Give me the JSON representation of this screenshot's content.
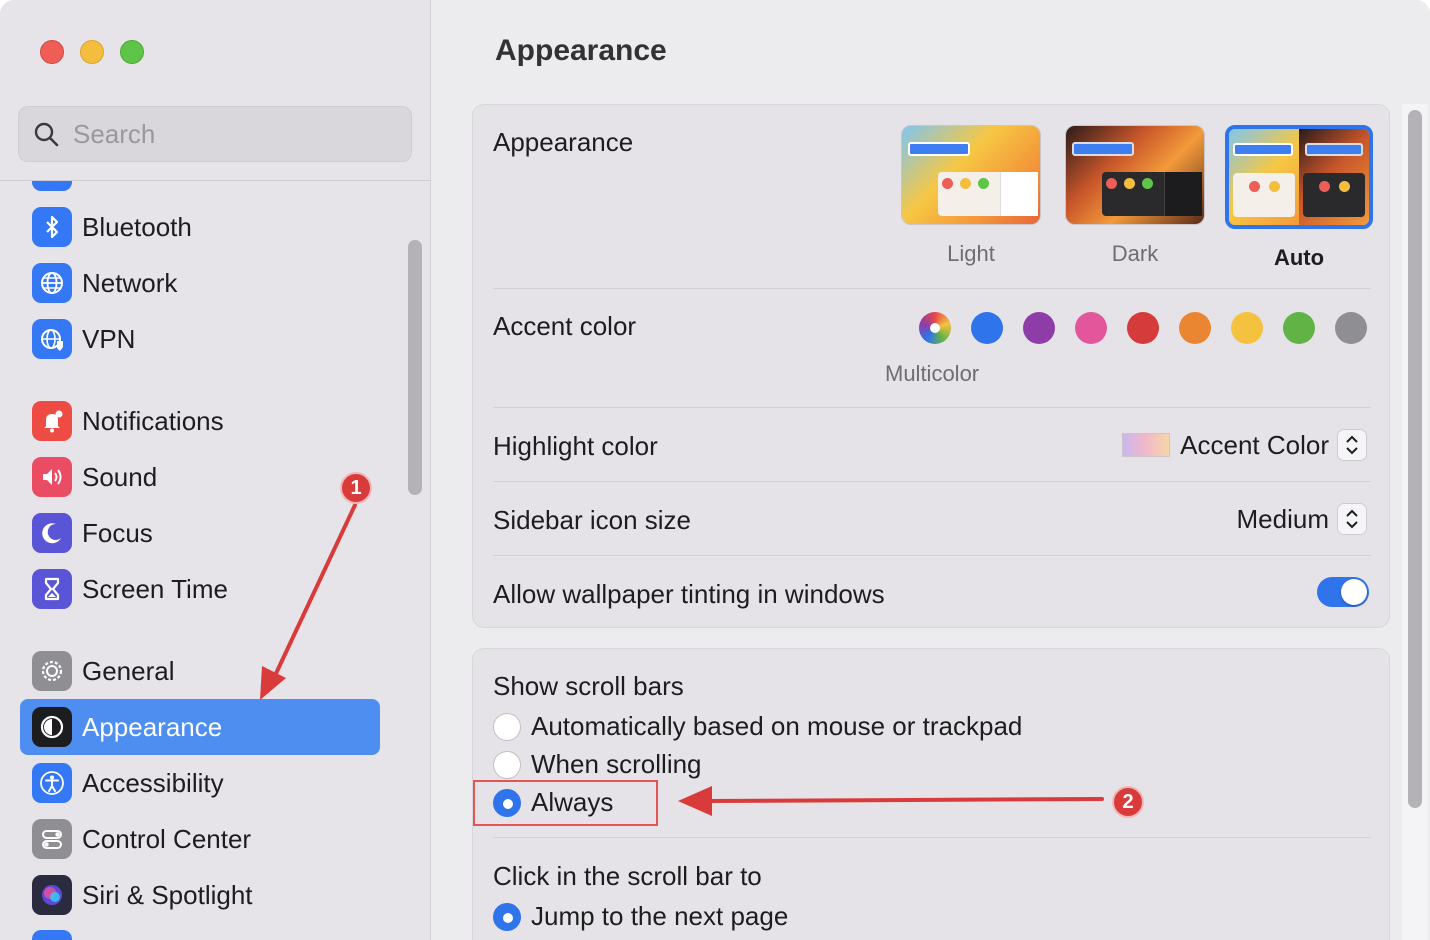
{
  "window": {
    "title": "Appearance"
  },
  "sidebar": {
    "search_placeholder": "Search",
    "items": [
      {
        "label": "Bluetooth",
        "icon": "bluetooth-icon",
        "color": "#3478f6"
      },
      {
        "label": "Network",
        "icon": "globe-icon",
        "color": "#3478f6"
      },
      {
        "label": "VPN",
        "icon": "vpn-icon",
        "color": "#3478f6"
      },
      {
        "label": "Notifications",
        "icon": "bell-icon",
        "color": "#ee4b45"
      },
      {
        "label": "Sound",
        "icon": "speaker-icon",
        "color": "#ea4c64"
      },
      {
        "label": "Focus",
        "icon": "moon-icon",
        "color": "#5a54d6"
      },
      {
        "label": "Screen Time",
        "icon": "hourglass-icon",
        "color": "#5a54d6"
      },
      {
        "label": "General",
        "icon": "gear-icon",
        "color": "#8e8e93"
      },
      {
        "label": "Appearance",
        "icon": "appearance-icon",
        "color": "#1d1d1f",
        "selected": true
      },
      {
        "label": "Accessibility",
        "icon": "accessibility-icon",
        "color": "#3478f6"
      },
      {
        "label": "Control Center",
        "icon": "control-center-icon",
        "color": "#8e8e93"
      },
      {
        "label": "Siri & Spotlight",
        "icon": "siri-icon",
        "color": "#2b2b40"
      }
    ]
  },
  "appearance_card": {
    "appearance_label": "Appearance",
    "themes": [
      {
        "label": "Light",
        "selected": false
      },
      {
        "label": "Dark",
        "selected": false
      },
      {
        "label": "Auto",
        "selected": true
      }
    ],
    "accent_label": "Accent color",
    "accent_colors": [
      "multicolor",
      "#2f74ea",
      "#8e3da8",
      "#e3569c",
      "#d53b3b",
      "#ea8532",
      "#f4c23f",
      "#62b346",
      "#8e8e93"
    ],
    "accent_caption": "Multicolor",
    "highlight_label": "Highlight color",
    "highlight_value": "Accent Color",
    "sidebar_icon_label": "Sidebar icon size",
    "sidebar_icon_value": "Medium",
    "tinting_label": "Allow wallpaper tinting in windows",
    "tinting_on": true
  },
  "scroll_card": {
    "show_label": "Show scroll bars",
    "options": [
      {
        "label": "Automatically based on mouse or trackpad",
        "selected": false
      },
      {
        "label": "When scrolling",
        "selected": false
      },
      {
        "label": "Always",
        "selected": true
      }
    ],
    "click_label": "Click in the scroll bar to",
    "click_options": [
      {
        "label": "Jump to the next page",
        "selected": true
      }
    ]
  },
  "annotations": {
    "badge1": "1",
    "badge2": "2",
    "accent": "#d93a3a"
  }
}
